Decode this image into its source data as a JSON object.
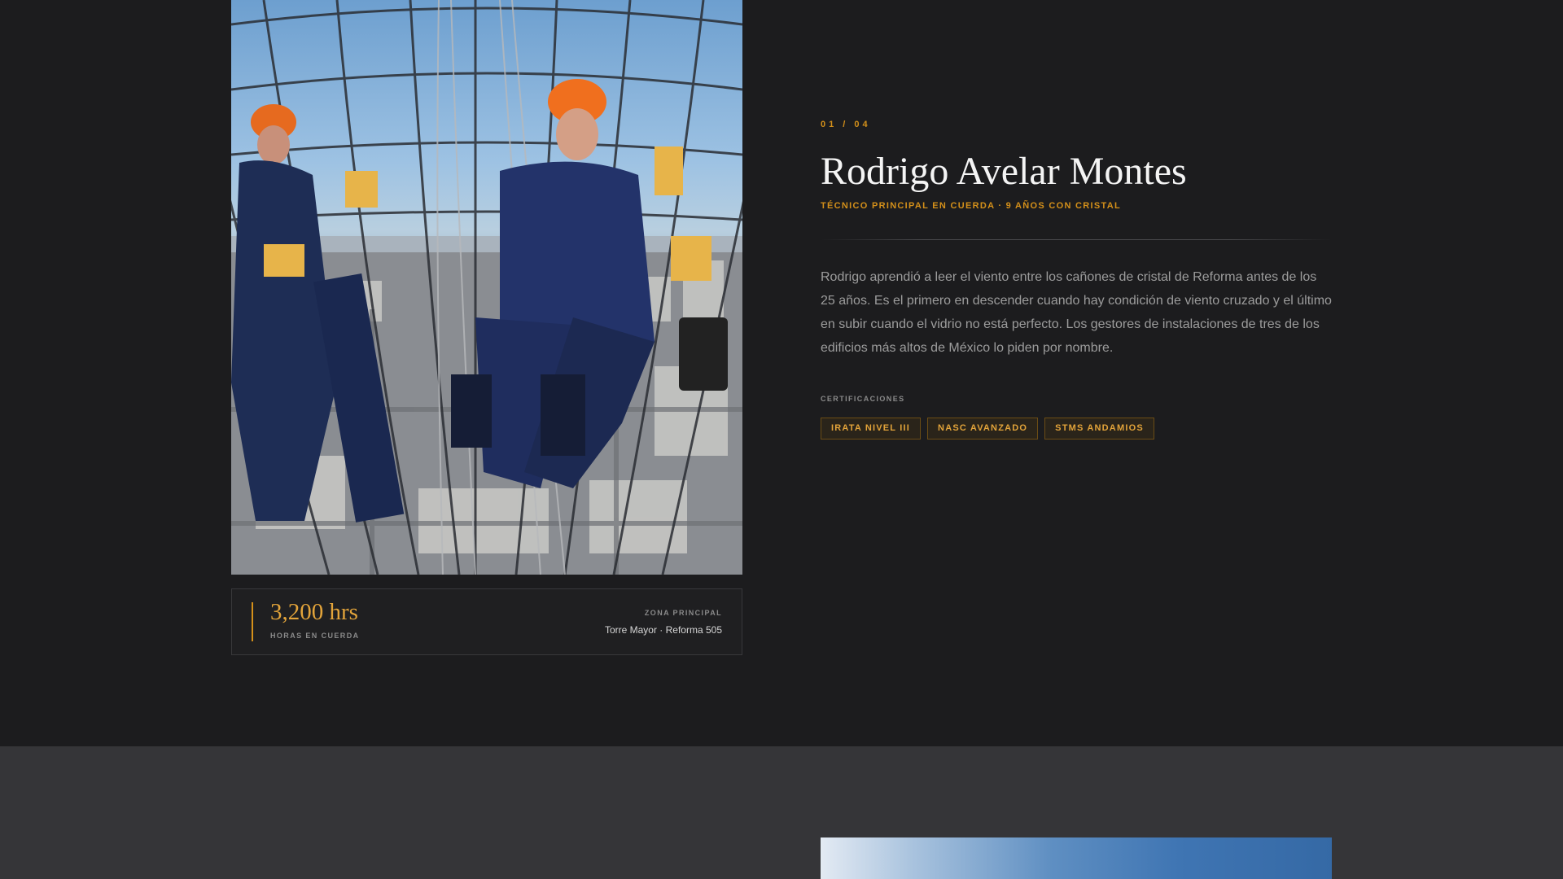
{
  "profile": {
    "counter": "01 / 04",
    "name": "Rodrigo Avelar Montes",
    "role": "TÉCNICO PRINCIPAL EN CUERDA · 9 AÑOS CON CRISTAL",
    "bio": "Rodrigo aprendió a leer el viento entre los cañones de cristal de Reforma antes de los 25 años. Es el primero en descender cuando hay condición de viento cruzado y el último en subir cuando el vidrio no está perfecto. Los gestores de instalaciones de tres de los edificios más altos de México lo piden por nombre.",
    "certifications_label": "CERTIFICACIONES",
    "certifications": [
      "IRATA NIVEL III",
      "NASC AVANZADO",
      "STMS ANDAMIOS"
    ]
  },
  "stats": {
    "hours_value": "3,200 hrs",
    "hours_label": "HORAS EN CUERDA",
    "zone_label": "ZONA PRINCIPAL",
    "zone_value": "Torre Mayor · Reforma 505"
  },
  "colors": {
    "accent": "#d4901a",
    "background": "#1c1c1e",
    "next_section_background": "#353538"
  }
}
